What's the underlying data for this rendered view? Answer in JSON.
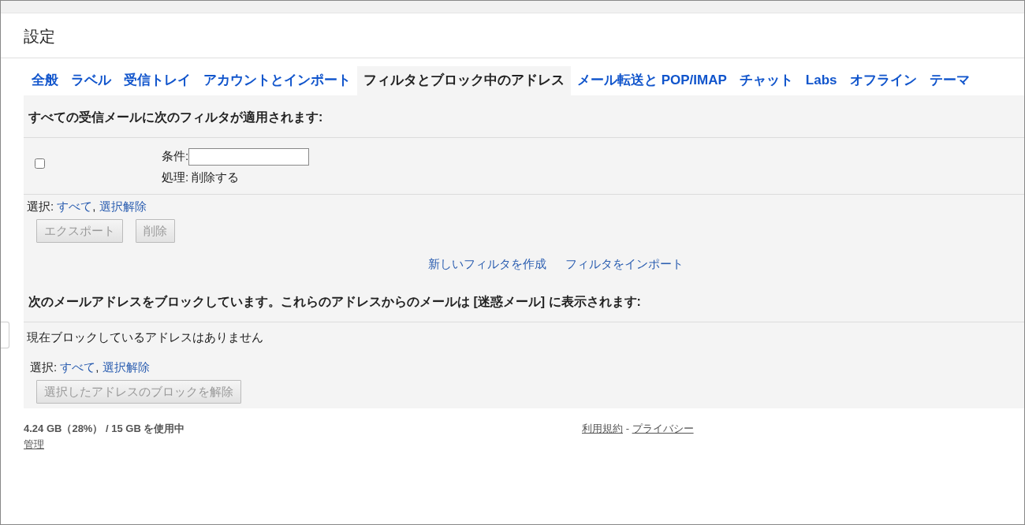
{
  "title": "設定",
  "tabs": [
    {
      "label": "全般",
      "selected": false
    },
    {
      "label": "ラベル",
      "selected": false
    },
    {
      "label": "受信トレイ",
      "selected": false
    },
    {
      "label": "アカウントとインポート",
      "selected": false
    },
    {
      "label": "フィルタとブロック中のアドレス",
      "selected": true
    },
    {
      "label": "メール転送と POP/IMAP",
      "selected": false
    },
    {
      "label": "チャット",
      "selected": false
    },
    {
      "label": "Labs",
      "selected": false
    },
    {
      "label": "オフライン",
      "selected": false
    },
    {
      "label": "テーマ",
      "selected": false
    }
  ],
  "filters": {
    "heading": "すべての受信メールに次のフィルタが適用されます:",
    "rows": [
      {
        "checked": false,
        "condition_label": "条件:",
        "action": "処理: 削除する"
      }
    ],
    "select": {
      "label": "選択:",
      "all": "すべて",
      "separator": ",",
      "none": "選択解除"
    },
    "buttons": [
      {
        "label": "エクスポート",
        "disabled": true
      },
      {
        "label": "削除",
        "disabled": true
      }
    ],
    "links": [
      "新しいフィルタを作成",
      "フィルタをインポート"
    ]
  },
  "blocked": {
    "heading": "次のメールアドレスをブロックしています。これらのアドレスからのメールは [迷惑メール] に表示されます:",
    "empty_text": "現在ブロックしているアドレスはありません",
    "select": {
      "label": "選択:",
      "all": "すべて",
      "separator": ",",
      "none": "選択解除"
    },
    "buttons": [
      {
        "label": "選択したアドレスのブロックを解除",
        "disabled": true
      }
    ]
  },
  "footer": {
    "storage": "4.24 GB（28%） / 15 GB を使用中",
    "manage": "管理",
    "terms": "利用規約",
    "separator": "-",
    "privacy": "プライバシー"
  }
}
